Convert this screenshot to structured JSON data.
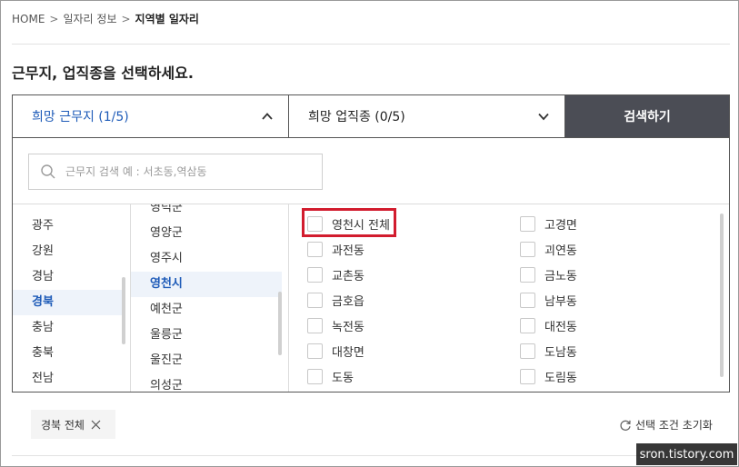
{
  "breadcrumb": {
    "home": "HOME",
    "sep1": ">",
    "section": "일자리 정보",
    "sep2": ">",
    "current": "지역별 일자리"
  },
  "title": "근무지, 업직종을 선택하세요.",
  "tabs": {
    "location": "희망 근무지 (1/5)",
    "job": "희망 업직종 (0/5)",
    "search_button": "검색하기"
  },
  "search": {
    "placeholder": "근무지 검색 예 : 서초동,역삼동"
  },
  "regions": [
    "광주",
    "강원",
    "경남",
    "경북",
    "충남",
    "충북",
    "전남"
  ],
  "active_region": "경북",
  "cities": [
    "영덕군",
    "영양군",
    "영주시",
    "영천시",
    "예천군",
    "울릉군",
    "울진군",
    "의성군"
  ],
  "active_city": "영천시",
  "dongs_left": [
    "영천시 전체",
    "과전동",
    "교촌동",
    "금호읍",
    "녹전동",
    "대창면",
    "도동"
  ],
  "dongs_right": [
    "고경면",
    "괴연동",
    "금노동",
    "남부동",
    "대전동",
    "도남동",
    "도림동"
  ],
  "selected_chip": {
    "label": "경북 전체"
  },
  "reset_label": "선택 조건 초기화",
  "watermark": "sron.tistory.com",
  "colors": {
    "accent": "#1e5bb8",
    "search_button_bg": "#4b4d55",
    "highlight": "#d21c2e"
  }
}
